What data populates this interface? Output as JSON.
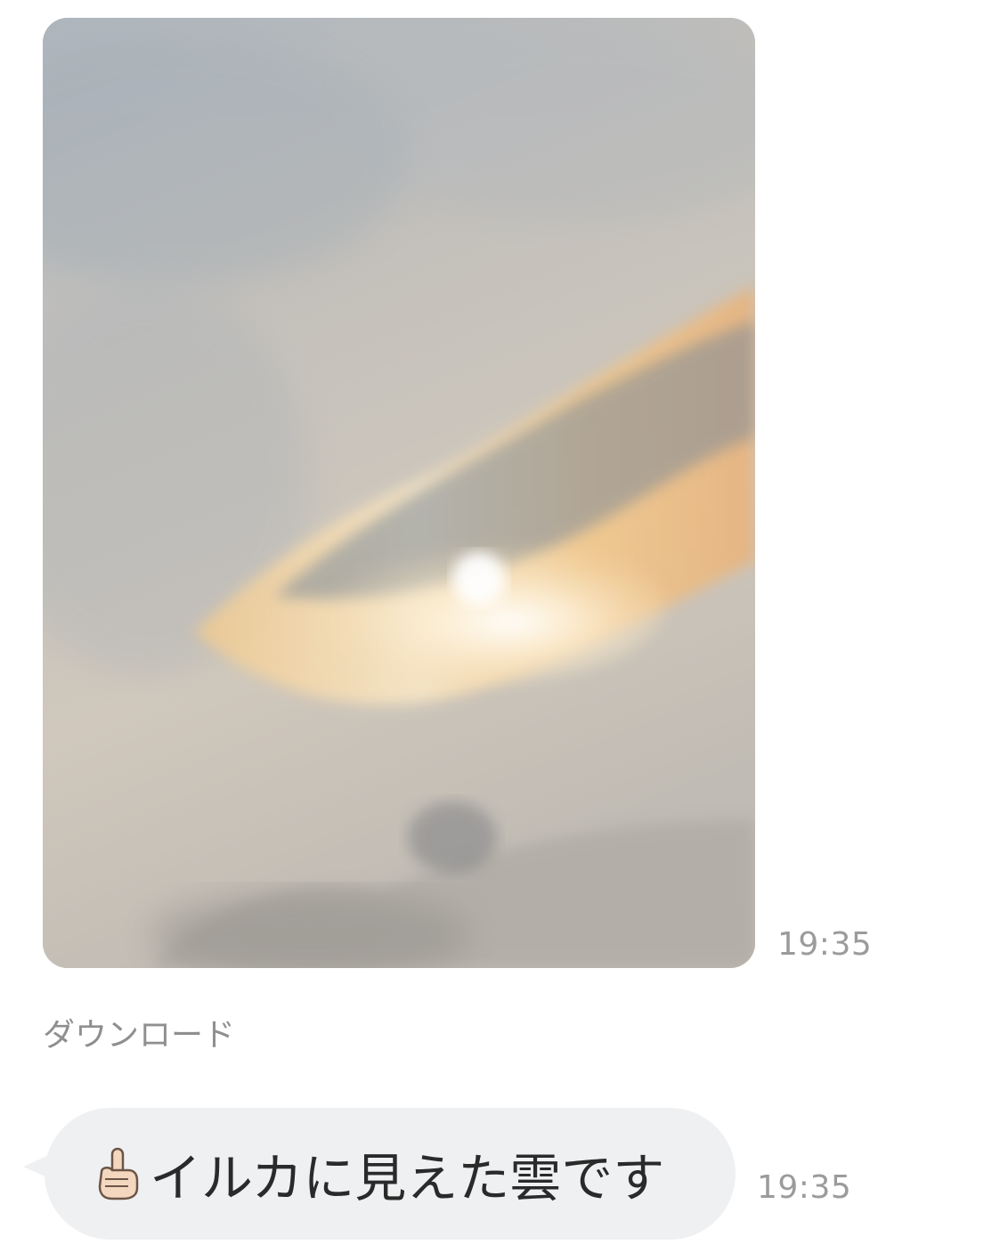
{
  "photo_message": {
    "time": "19:35",
    "download_label": "ダウンロード"
  },
  "text_message": {
    "emoji_icon": "index-pointing-up-icon",
    "text": "イルカに見えた雲です",
    "time": "19:35"
  },
  "colors": {
    "bubble_bg": "#eff0f2",
    "timestamp": "#9b9b9b",
    "download_text": "#8f8f8f"
  }
}
